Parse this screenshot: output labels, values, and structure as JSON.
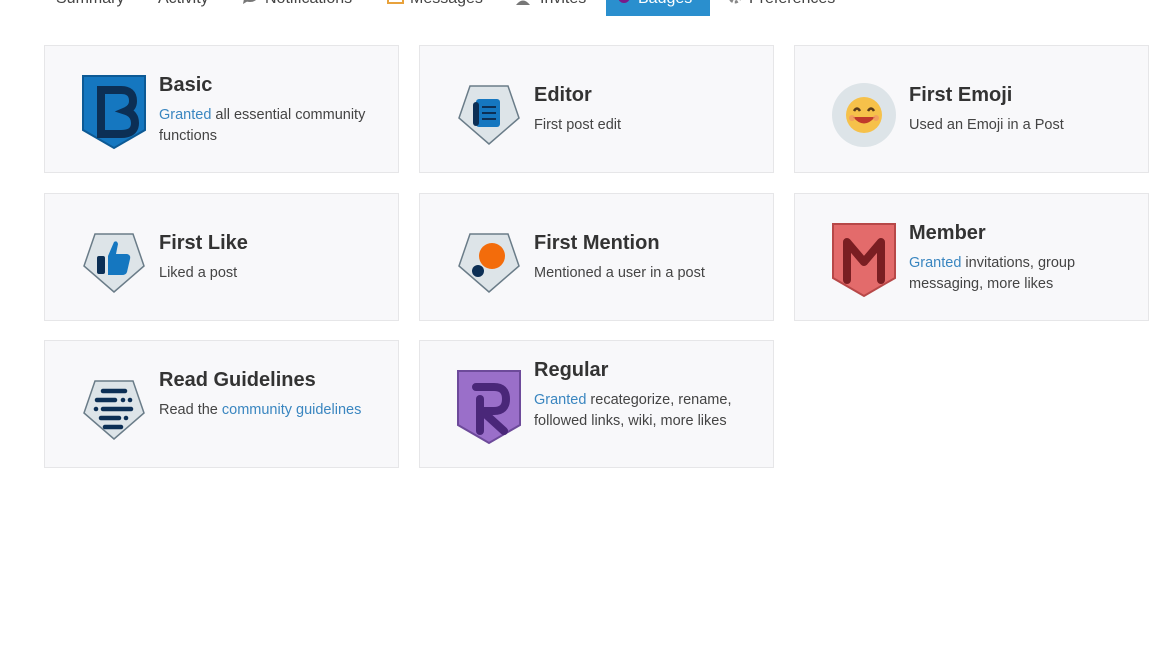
{
  "nav": {
    "items": [
      {
        "label": "Summary",
        "icon": ""
      },
      {
        "label": "Activity",
        "icon": ""
      },
      {
        "label": "Notifications",
        "icon": "comment-icon"
      },
      {
        "label": "Messages",
        "icon": "envelope-icon"
      },
      {
        "label": "Invites",
        "icon": "user-plus-icon"
      },
      {
        "label": "Badges",
        "icon": "certificate-icon"
      },
      {
        "label": "Preferences",
        "icon": "gear-icon"
      }
    ],
    "active": "Badges",
    "active_color": "#2a8fce"
  },
  "badges": [
    {
      "title": "Basic",
      "desc_link": "Granted",
      "desc_rest": " all essential community functions"
    },
    {
      "title": "Editor",
      "desc_link": "",
      "desc_rest": "First post edit"
    },
    {
      "title": "First Emoji",
      "desc_link": "",
      "desc_rest": "Used an Emoji in a Post"
    },
    {
      "title": "First Like",
      "desc_link": "",
      "desc_rest": "Liked a post"
    },
    {
      "title": "First Mention",
      "desc_link": "",
      "desc_rest": "Mentioned a user in a post"
    },
    {
      "title": "Member",
      "desc_link": "Granted",
      "desc_rest": " invitations, group messaging, more likes"
    },
    {
      "title": "Read Guidelines",
      "desc_prefix": "Read the ",
      "desc_link": "community guidelines",
      "desc_rest": ""
    },
    {
      "title": "Regular",
      "desc_link": "Granted",
      "desc_rest": " recategorize, rename, followed links, wiki, more likes"
    }
  ],
  "colors": {
    "link": "#3a86c0",
    "basic": "#1577c0",
    "member": "#e36b6b",
    "regular": "#9a6fc9",
    "neutral_badge": "#dde4e8"
  }
}
